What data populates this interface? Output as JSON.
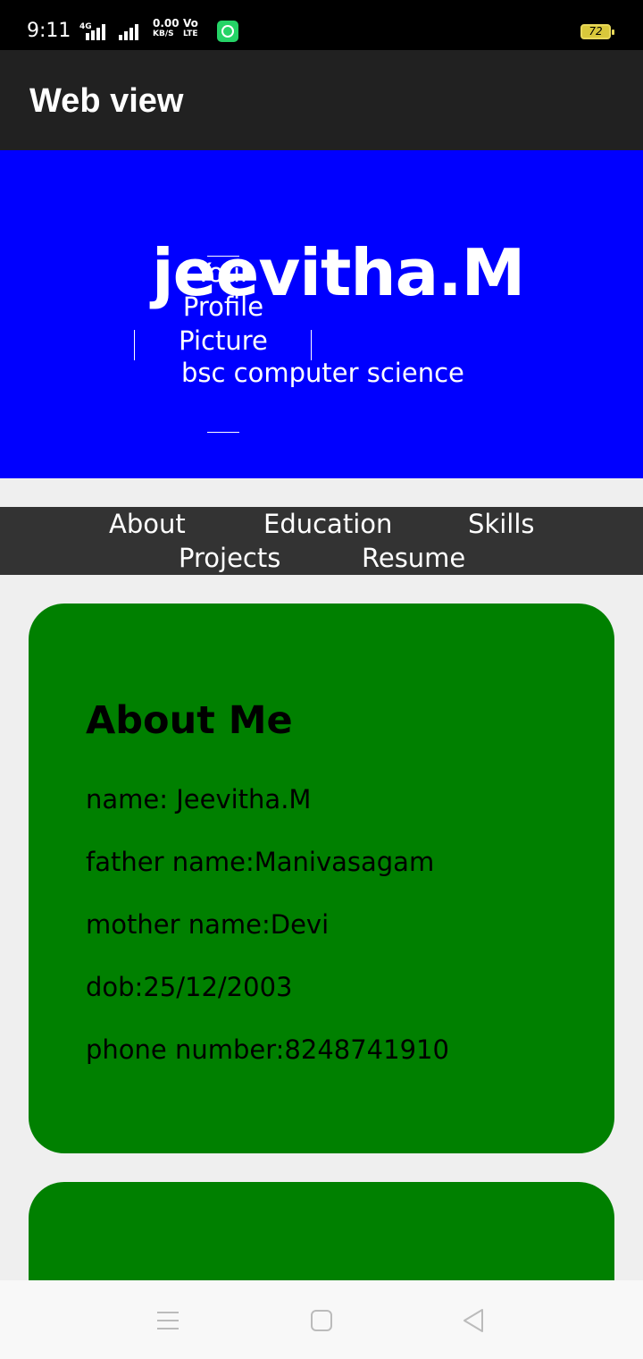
{
  "status_bar": {
    "time": "9:11",
    "network_type": "4G",
    "data_speed_value": "0.00",
    "data_speed_unit": "KB/S",
    "volte_top": "Vo",
    "volte_bottom": "LTE",
    "battery": "72",
    "icons": [
      "signal-icon",
      "whatsapp-icon",
      "battery-icon"
    ]
  },
  "app_bar": {
    "title": "Web view"
  },
  "header": {
    "name": "jeevitha.M",
    "profile_alt_line1": "Your",
    "profile_alt_line2": "Profile",
    "profile_alt_line3": "Picture",
    "subtitle": "bsc computer science"
  },
  "nav": {
    "items": [
      "About",
      "Education",
      "Skills",
      "Projects",
      "Resume"
    ]
  },
  "about": {
    "title": "About Me",
    "lines": [
      "name: Jeevitha.M",
      "father name:Manivasagam",
      "mother name:Devi",
      "dob:25/12/2003",
      "phone number:8248741910"
    ]
  },
  "colors": {
    "header_bg": "#0000ff",
    "card_bg": "#008000",
    "nav_bg": "#333333",
    "app_bar_bg": "#212121"
  },
  "system_nav": {
    "icons": [
      "menu-icon",
      "home-icon",
      "back-icon"
    ]
  }
}
